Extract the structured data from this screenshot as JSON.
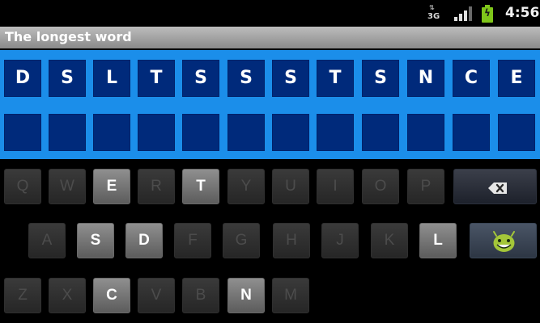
{
  "status_bar": {
    "network_type": "3G",
    "network_arrows": "⇅",
    "clock": "4:56",
    "signal_level": 0.75,
    "battery_color": "#7fc61a"
  },
  "app": {
    "title": "The longest word"
  },
  "board": {
    "letters": [
      "D",
      "S",
      "L",
      "T",
      "S",
      "S",
      "S",
      "T",
      "S",
      "N",
      "C",
      "E"
    ],
    "answer": [
      "",
      "",
      "",
      "",
      "",
      "",
      "",
      "",
      "",
      "",
      "",
      ""
    ],
    "tile_color": "#002a7b",
    "background_color": "#1b8eea"
  },
  "keyboard": {
    "rows": [
      [
        "Q",
        "W",
        "E",
        "R",
        "T",
        "Y",
        "U",
        "I",
        "O",
        "P"
      ],
      [
        "A",
        "S",
        "D",
        "F",
        "G",
        "H",
        "J",
        "K",
        "L"
      ],
      [
        "Z",
        "X",
        "C",
        "V",
        "B",
        "N",
        "M"
      ]
    ],
    "active_keys": [
      "E",
      "T",
      "S",
      "D",
      "L",
      "C",
      "N"
    ],
    "backspace_icon": "backspace-icon",
    "emoji_icon": "android-smiley-icon"
  }
}
